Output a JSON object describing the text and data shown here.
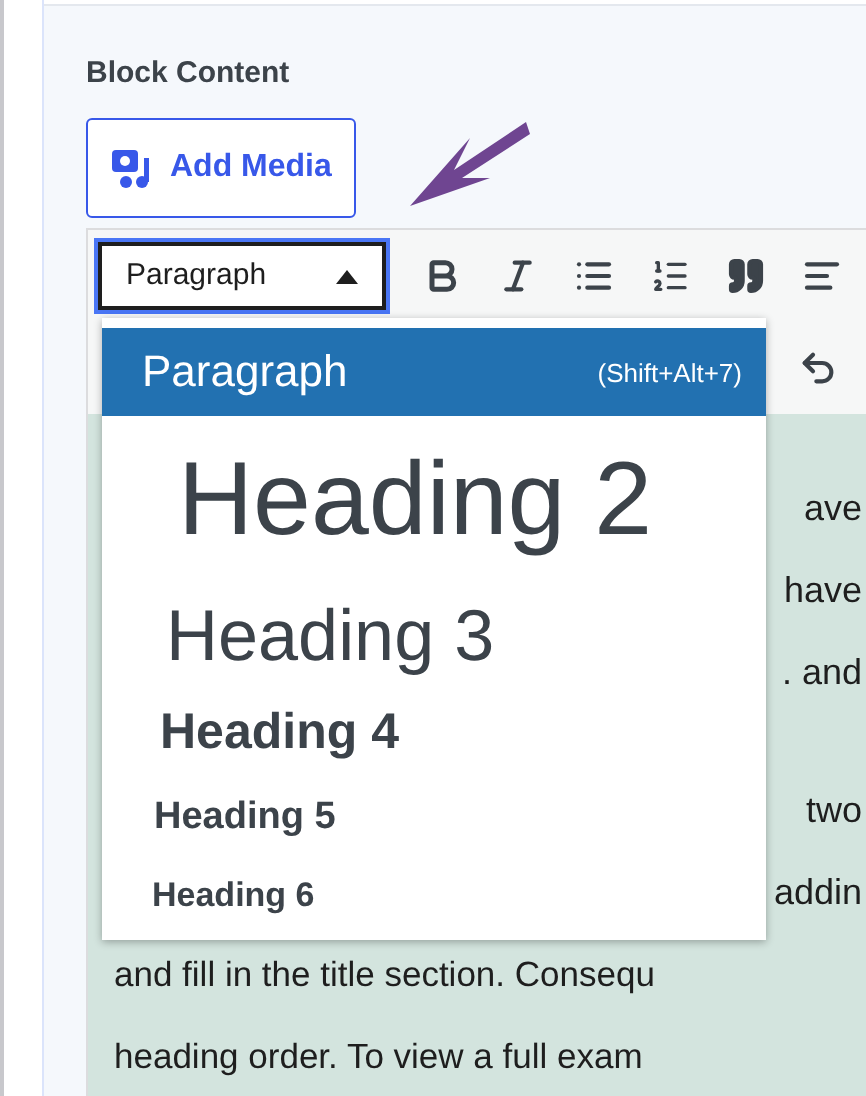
{
  "section_label": "Block Content",
  "add_media": {
    "label": "Add Media"
  },
  "format_select": {
    "value": "Paragraph",
    "expanded": true
  },
  "format_menu": [
    {
      "kind": "paragraph",
      "label": "Paragraph",
      "shortcut": "(Shift+Alt+7)",
      "selected": true
    },
    {
      "kind": "h2",
      "label": "Heading 2",
      "selected": false
    },
    {
      "kind": "h3",
      "label": "Heading 3",
      "selected": false
    },
    {
      "kind": "h4",
      "label": "Heading 4",
      "selected": false
    },
    {
      "kind": "h5",
      "label": "Heading 5",
      "selected": false
    },
    {
      "kind": "h6",
      "label": "Heading 6",
      "selected": false
    }
  ],
  "content_paragraphs": [
    [
      "ave",
      "have",
      ". and"
    ],
    [
      "two",
      "addin",
      "and fill in the title section. Consequ",
      "heading order. To view a full exam"
    ]
  ]
}
